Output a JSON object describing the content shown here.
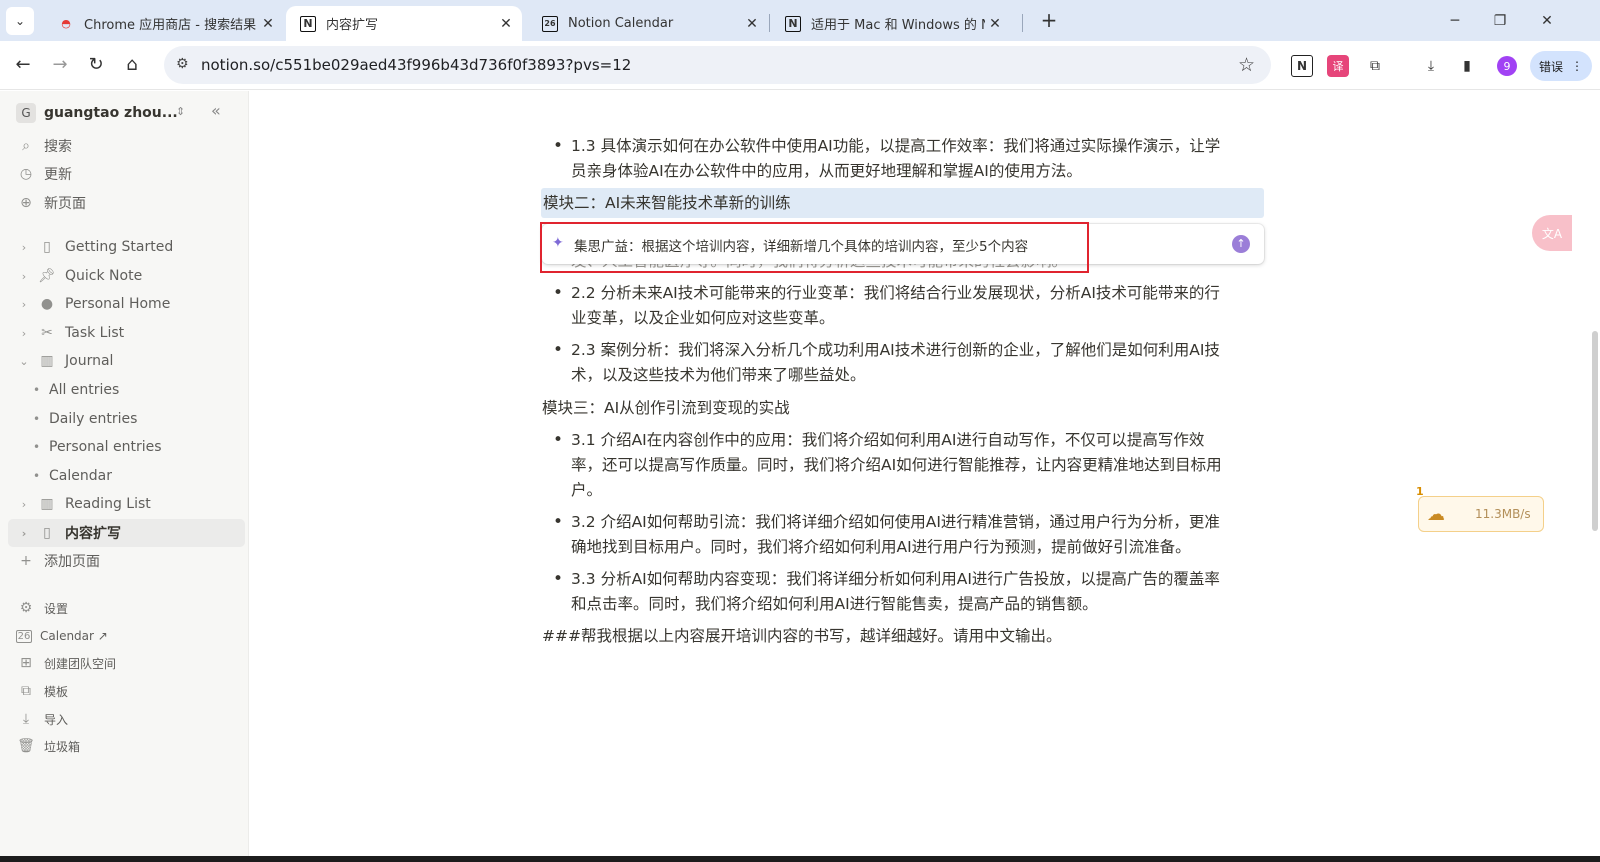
{
  "browser": {
    "tabs": [
      {
        "title": "Chrome 应用商店 - 搜索结果",
        "favicon": "chrome-webstore-icon"
      },
      {
        "title": "内容扩写",
        "favicon": "notion-icon"
      },
      {
        "title": "Notion Calendar",
        "favicon": "notion-calendar-icon"
      },
      {
        "title": "适用于 Mac 和 Windows 的 N",
        "favicon": "notion-icon"
      }
    ],
    "url": "notion.so/c551be029aed43f996b43d736f0f3893?pvs=12",
    "profile_initial": "9",
    "error_button": "错误"
  },
  "sidebar": {
    "workspace_initial": "G",
    "workspace_name": "guangtao zhou...",
    "top_items": [
      {
        "label": "搜索",
        "icon": "search-icon"
      },
      {
        "label": "更新",
        "icon": "clock-icon"
      },
      {
        "label": "新页面",
        "icon": "plus-circle-icon"
      }
    ],
    "pages": [
      {
        "label": "Getting Started",
        "icon": "page-icon"
      },
      {
        "label": "Quick Note",
        "icon": "pin-icon"
      },
      {
        "label": "Personal Home",
        "icon": "person-icon"
      },
      {
        "label": "Task List",
        "icon": "tools-icon"
      },
      {
        "label": "Journal",
        "icon": "book-icon"
      },
      {
        "label": "All entries"
      },
      {
        "label": "Daily entries"
      },
      {
        "label": "Personal entries"
      },
      {
        "label": "Calendar"
      },
      {
        "label": "Reading List",
        "icon": "book-icon"
      },
      {
        "label": "内容扩写",
        "icon": "page-icon"
      }
    ],
    "add_page": "添加页面",
    "bottom_items": [
      {
        "label": "设置",
        "icon": "gear-icon"
      },
      {
        "label": "Calendar ↗",
        "icon": "calendar-icon"
      },
      {
        "label": "创建团队空间",
        "icon": "team-icon"
      },
      {
        "label": "模板",
        "icon": "template-icon"
      },
      {
        "label": "导入",
        "icon": "download-icon"
      },
      {
        "label": "垃圾箱",
        "icon": "trash-icon"
      }
    ]
  },
  "content": {
    "b13_line1": "1.3 具体演示如何在办公软件中使用AI功能，以提高工作效率：我们将通过实际操作演示，让学",
    "b13_line2": "员亲身体验AI在办公软件中的应用，从而更好地理解和掌握AI的使用方法。",
    "module2": "模块二：AI未来智能技术革新的训练",
    "ai_prompt": "集思广益：根据这个培训内容，详细新增几个具体的培训内容，至少5个内容",
    "hidden_line": "发、人工智能医疗等。同时，我们将分析这些技术可能带来的社会影响。",
    "b22_line1": "2.2 分析未来AI技术可能带来的行业变革：我们将结合行业发展现状，分析AI技术可能带来的行",
    "b22_line2": "业变革，以及企业如何应对这些变革。",
    "b23_line1": "2.3 案例分析：我们将深入分析几个成功利用AI技术进行创新的企业，了解他们是如何利用AI技",
    "b23_line2": "术，以及这些技术为他们带来了哪些益处。",
    "module3": "模块三：AI从创作引流到变现的实战",
    "b31_line1": "3.1 介绍AI在内容创作中的应用：我们将介绍如何利用AI进行自动写作，不仅可以提高写作效",
    "b31_line2": "率，还可以提高写作质量。同时，我们将介绍AI如何进行智能推荐，让内容更精准地达到目标用",
    "b31_line3": "户。",
    "b32_line1": "3.2 介绍AI如何帮助引流：我们将详细介绍如何使用AI进行精准营销，通过用户行为分析，更准",
    "b32_line2": "确地找到目标用户。同时，我们将介绍如何利用AI进行用户行为预测，提前做好引流准备。",
    "b33_line1": "3.3 分析AI如何帮助内容变现：我们将详细分析如何利用AI进行广告投放，以提高广告的覆盖率",
    "b33_line2": "和点击率。同时，我们将介绍如何利用AI进行智能售卖，提高产品的销售额。",
    "final": "###帮我根据以上内容展开培训内容的书写，越详细越好。请用中文输出。"
  },
  "overlay": {
    "net_count": "1",
    "net_speed": "11.3MB/s"
  },
  "colors": {
    "tabstrip": "#dfe8f6",
    "highlight": "#dfeaf6",
    "ai_accent": "#9b7ed8",
    "annotation_frame": "#e0242f"
  }
}
